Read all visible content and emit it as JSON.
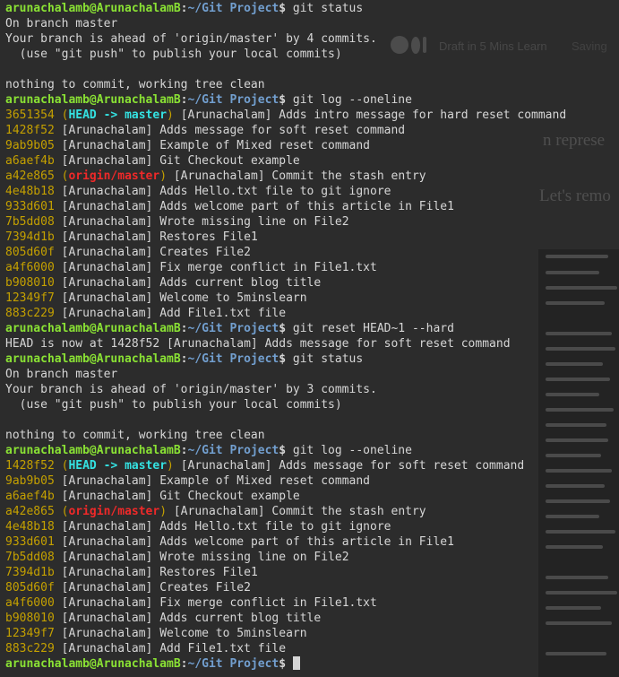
{
  "background": {
    "medium_draft_text": "Draft in 5 Mins Learn",
    "medium_saving_text": "Saving",
    "article_heading_fragment": "n  represe",
    "article_paragraph_fragment": "Let's remo"
  },
  "prompt": {
    "user_host": "arunachalamb@ArunachalamB",
    "separator": ":",
    "cwd": "~/Git Project",
    "symbol": "$ "
  },
  "colors": {
    "user_host": "#8ae234",
    "cwd": "#729fcf",
    "hash": "#c4a000",
    "head_ref": "#34e2e2",
    "origin_ref": "#ef2929",
    "text": "#d6d6d6",
    "background": "#2c2c2c"
  },
  "terminal": [
    {
      "kind": "prompt",
      "cmd": "git status"
    },
    {
      "kind": "text",
      "text": "On branch master"
    },
    {
      "kind": "text",
      "text": "Your branch is ahead of 'origin/master' by 4 commits."
    },
    {
      "kind": "text",
      "text": "  (use \"git push\" to publish your local commits)"
    },
    {
      "kind": "text",
      "text": ""
    },
    {
      "kind": "text",
      "text": "nothing to commit, working tree clean"
    },
    {
      "kind": "prompt",
      "cmd": "git log --oneline"
    },
    {
      "kind": "commit",
      "hash": "3651354",
      "ref": "head",
      "ref_label": "HEAD -> master",
      "msg": "[Arunachalam] Adds intro message for hard reset command"
    },
    {
      "kind": "commit",
      "hash": "1428f52",
      "msg": "[Arunachalam] Adds message for soft reset command"
    },
    {
      "kind": "commit",
      "hash": "9ab9b05",
      "msg": "[Arunachalam] Example of Mixed reset command"
    },
    {
      "kind": "commit",
      "hash": "a6aef4b",
      "msg": "[Arunachalam] Git Checkout example"
    },
    {
      "kind": "commit",
      "hash": "a42e865",
      "ref": "origin",
      "ref_label": "origin/master",
      "msg": "[Arunachalam] Commit the stash entry"
    },
    {
      "kind": "commit",
      "hash": "4e48b18",
      "msg": "[Arunachalam] Adds Hello.txt file to git ignore"
    },
    {
      "kind": "commit",
      "hash": "933d601",
      "msg": "[Arunachalam] Adds welcome part of this article in File1"
    },
    {
      "kind": "commit",
      "hash": "7b5dd08",
      "msg": "[Arunachalam] Wrote missing line on File2"
    },
    {
      "kind": "commit",
      "hash": "7394d1b",
      "msg": "[Arunachalam] Restores File1"
    },
    {
      "kind": "commit",
      "hash": "805d60f",
      "msg": "[Arunachalam] Creates File2"
    },
    {
      "kind": "commit",
      "hash": "a4f6000",
      "msg": "[Arunachalam] Fix merge conflict in File1.txt"
    },
    {
      "kind": "commit",
      "hash": "b908010",
      "msg": "[Arunachalam] Adds current blog title"
    },
    {
      "kind": "commit",
      "hash": "12349f7",
      "msg": "[Arunachalam] Welcome to 5minslearn"
    },
    {
      "kind": "commit",
      "hash": "883c229",
      "msg": "[Arunachalam] Add File1.txt file"
    },
    {
      "kind": "prompt",
      "cmd": "git reset HEAD~1 --hard"
    },
    {
      "kind": "text",
      "text": "HEAD is now at 1428f52 [Arunachalam] Adds message for soft reset command"
    },
    {
      "kind": "prompt",
      "cmd": "git status"
    },
    {
      "kind": "text",
      "text": "On branch master"
    },
    {
      "kind": "text",
      "text": "Your branch is ahead of 'origin/master' by 3 commits."
    },
    {
      "kind": "text",
      "text": "  (use \"git push\" to publish your local commits)"
    },
    {
      "kind": "text",
      "text": ""
    },
    {
      "kind": "text",
      "text": "nothing to commit, working tree clean"
    },
    {
      "kind": "prompt",
      "cmd": "git log --oneline"
    },
    {
      "kind": "commit",
      "hash": "1428f52",
      "ref": "head",
      "ref_label": "HEAD -> master",
      "msg": "[Arunachalam] Adds message for soft reset command"
    },
    {
      "kind": "commit",
      "hash": "9ab9b05",
      "msg": "[Arunachalam] Example of Mixed reset command"
    },
    {
      "kind": "commit",
      "hash": "a6aef4b",
      "msg": "[Arunachalam] Git Checkout example"
    },
    {
      "kind": "commit",
      "hash": "a42e865",
      "ref": "origin",
      "ref_label": "origin/master",
      "msg": "[Arunachalam] Commit the stash entry"
    },
    {
      "kind": "commit",
      "hash": "4e48b18",
      "msg": "[Arunachalam] Adds Hello.txt file to git ignore"
    },
    {
      "kind": "commit",
      "hash": "933d601",
      "msg": "[Arunachalam] Adds welcome part of this article in File1"
    },
    {
      "kind": "commit",
      "hash": "7b5dd08",
      "msg": "[Arunachalam] Wrote missing line on File2"
    },
    {
      "kind": "commit",
      "hash": "7394d1b",
      "msg": "[Arunachalam] Restores File1"
    },
    {
      "kind": "commit",
      "hash": "805d60f",
      "msg": "[Arunachalam] Creates File2"
    },
    {
      "kind": "commit",
      "hash": "a4f6000",
      "msg": "[Arunachalam] Fix merge conflict in File1.txt"
    },
    {
      "kind": "commit",
      "hash": "b908010",
      "msg": "[Arunachalam] Adds current blog title"
    },
    {
      "kind": "commit",
      "hash": "12349f7",
      "msg": "[Arunachalam] Welcome to 5minslearn"
    },
    {
      "kind": "commit",
      "hash": "883c229",
      "msg": "[Arunachalam] Add File1.txt file"
    },
    {
      "kind": "prompt",
      "cmd": "",
      "cursor": true
    }
  ]
}
